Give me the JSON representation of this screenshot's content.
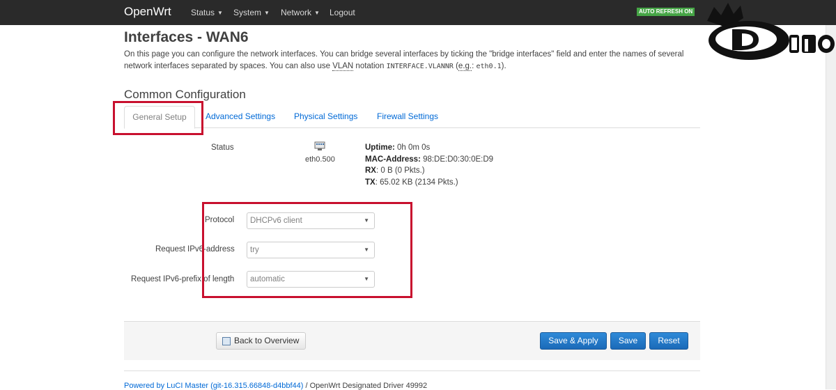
{
  "navbar": {
    "brand": "OpenWrt",
    "menu": [
      {
        "label": "Status",
        "dropdown": true
      },
      {
        "label": "System",
        "dropdown": true
      },
      {
        "label": "Network",
        "dropdown": true
      },
      {
        "label": "Logout",
        "dropdown": false
      }
    ],
    "auto_refresh": "AUTO REFRESH ON"
  },
  "page": {
    "title": "Interfaces - WAN6",
    "description_text1": "On this page you can configure the network interfaces. You can bridge several interfaces by ticking the \"bridge interfaces\" field and enter the names of several network interfaces separated by spaces. You can also use ",
    "description_vlan": "VLAN",
    "description_text2": " notation ",
    "description_code": "INTERFACE.VLANNR",
    "description_text3": " (",
    "description_eg": "e.g.",
    "description_text4": ": ",
    "description_code2": "eth0.1",
    "description_text5": ")."
  },
  "section": {
    "title": "Common Configuration",
    "tabs": [
      {
        "label": "General Setup",
        "active": true
      },
      {
        "label": "Advanced Settings",
        "active": false
      },
      {
        "label": "Physical Settings",
        "active": false
      },
      {
        "label": "Firewall Settings",
        "active": false
      }
    ]
  },
  "status": {
    "label": "Status",
    "device": "eth0.500",
    "icon": "ethernet-port-icon",
    "uptime_label": "Uptime:",
    "uptime_value": " 0h 0m 0s",
    "mac_label": "MAC-Address:",
    "mac_value": " 98:DE:D0:30:0E:D9",
    "rx_label": "RX",
    "rx_value": ": 0 B (0 Pkts.)",
    "tx_label": "TX",
    "tx_value": ": 65.02 KB (2134 Pkts.)"
  },
  "form": {
    "protocol_label": "Protocol",
    "protocol_value": "DHCPv6 client",
    "request_address_label": "Request IPv6-address",
    "request_address_value": "try",
    "request_prefix_label": "Request IPv6-prefix of length",
    "request_prefix_value": "automatic"
  },
  "actions": {
    "back": "Back to Overview",
    "save_apply": "Save & Apply",
    "save": "Save",
    "reset": "Reset"
  },
  "footer": {
    "powered_by": "Powered by LuCI Master (git-16.315.66848-d4bbf44)",
    "separator": " / ",
    "driver": "OpenWrt Designated Driver 49992"
  },
  "colors": {
    "navbar": "#2a2a2a",
    "link": "#0069d6",
    "badge": "#46a546",
    "highlight": "#c8102e",
    "primary_button": "#1b6ab8"
  },
  "watermark": {
    "text": "DINO"
  }
}
